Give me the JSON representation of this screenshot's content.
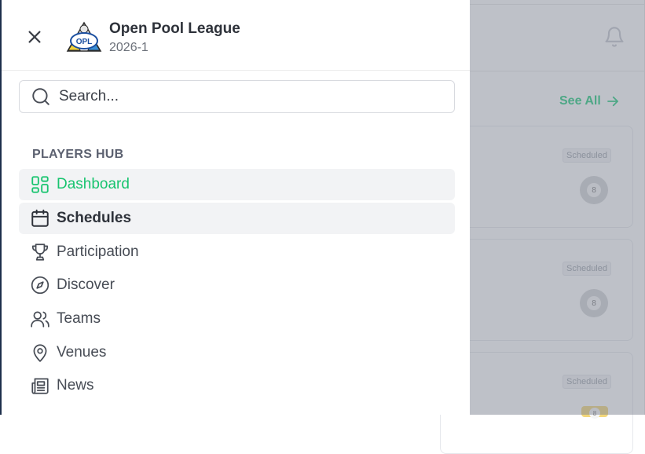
{
  "league": {
    "name": "Open Pool League",
    "season": "2026-1",
    "logo_text": "OPL"
  },
  "search": {
    "placeholder": "Search..."
  },
  "nav": {
    "section_title": "PLAYERS HUB",
    "items": [
      {
        "label": "Dashboard",
        "icon": "dashboard-icon",
        "state": "active"
      },
      {
        "label": "Schedules",
        "icon": "calendar-icon",
        "state": "hover"
      },
      {
        "label": "Participation",
        "icon": "trophy-icon",
        "state": "normal"
      },
      {
        "label": "Discover",
        "icon": "compass-icon",
        "state": "normal"
      },
      {
        "label": "Teams",
        "icon": "users-icon",
        "state": "normal"
      },
      {
        "label": "Venues",
        "icon": "map-pin-icon",
        "state": "normal"
      },
      {
        "label": "News",
        "icon": "newspaper-icon",
        "state": "normal"
      }
    ]
  },
  "background": {
    "see_all_label": "See All",
    "cards": [
      {
        "status": "Scheduled",
        "ball_number": "8"
      },
      {
        "status": "Scheduled",
        "ball_number": "8"
      },
      {
        "status": "Scheduled",
        "ball_number": "8"
      }
    ]
  },
  "colors": {
    "accent_green": "#18c46f",
    "drawer_border": "#1e2f4b",
    "overlay": "rgba(125,132,145,0.5)"
  }
}
